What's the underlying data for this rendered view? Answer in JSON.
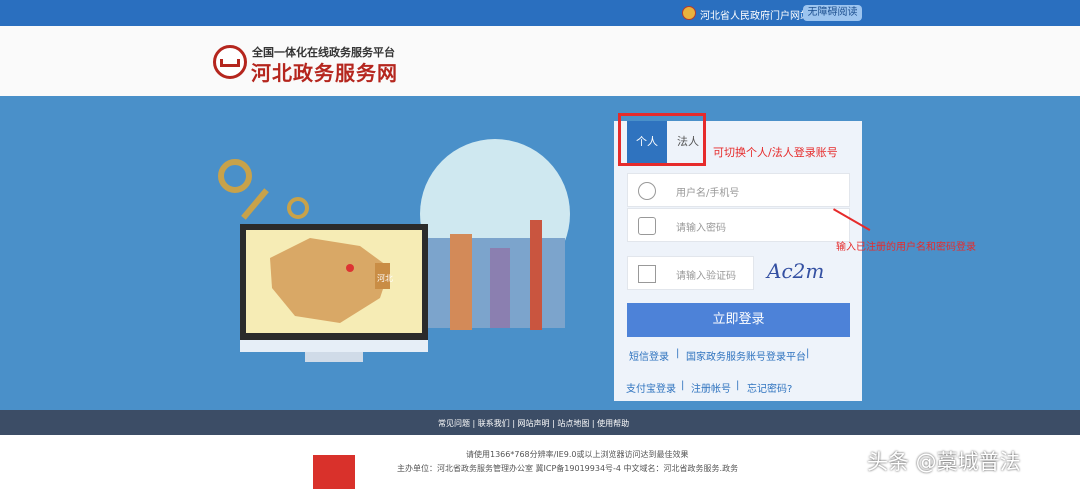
{
  "topbar": {
    "gov_link": "河北省人民政府门户网站",
    "accessible_label": "无障碍阅读"
  },
  "header": {
    "subtitle": "全国一体化在线政务服务平台",
    "title": "河北政务服务网"
  },
  "login": {
    "tabs": [
      "个人",
      "法人"
    ],
    "note_switch": "可切换个人/法人登录账号",
    "username_placeholder": "用户名/手机号",
    "password_placeholder": "请输入密码",
    "captcha_placeholder": "请输入验证码",
    "captcha_text": "Ac2m",
    "submit": "立即登录",
    "links_row1": [
      "短信登录",
      "国家政务服务账号登录平台"
    ],
    "links_row2": [
      "支付宝登录",
      "注册帐号",
      "忘记密码?"
    ],
    "note_input": "输入已注册的用户名和密码登录"
  },
  "footer": {
    "links": "常见问题 | 联系我们 | 网站声明 | 站点地图 | 使用帮助"
  },
  "bottom": {
    "line1": "请使用1366*768分辨率/IE9.0或以上浏览器访问达到最佳效果",
    "line2": "主办单位：河北省政务服务管理办公室    冀ICP备19019934号-4    中文域名：河北省政务服务.政务"
  },
  "watermark": "头条 @藁城普法",
  "illustration": {
    "map_label": "河北"
  },
  "colors": {
    "accent": "#2f73bf",
    "brand": "#b5261e",
    "hero": "#4a90c9",
    "annotation": "#e62b2b"
  }
}
